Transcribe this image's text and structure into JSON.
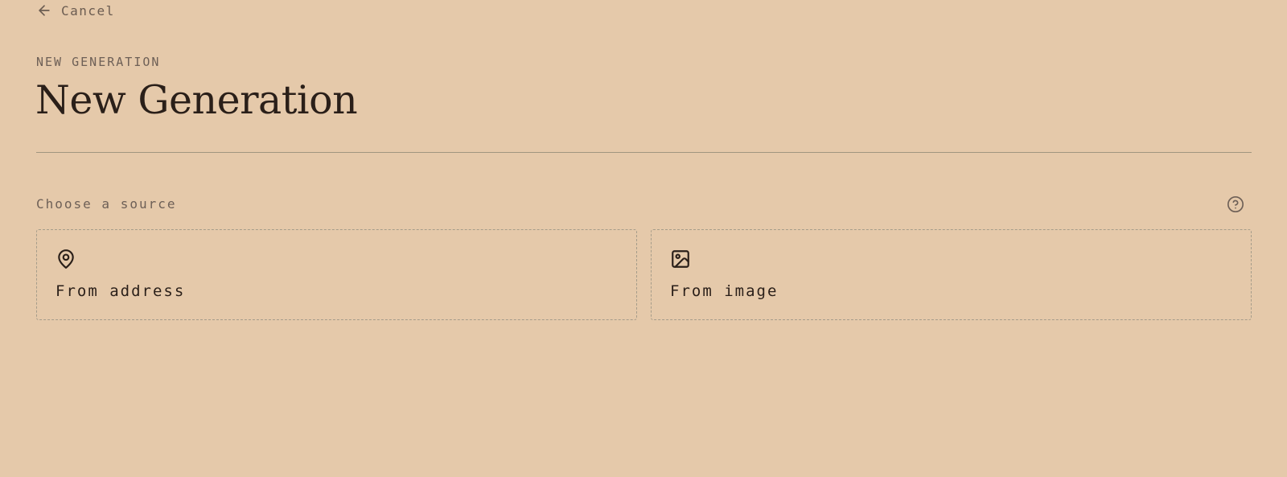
{
  "nav": {
    "cancel_label": "Cancel",
    "cancel_icon": "arrow-left-icon"
  },
  "header": {
    "eyebrow": "NEW GENERATION",
    "title": "New Generation"
  },
  "source_section": {
    "label": "Choose a source",
    "help_icon": "help-circle-icon",
    "options": [
      {
        "label": "From address",
        "icon": "map-pin-icon"
      },
      {
        "label": "From image",
        "icon": "image-icon"
      }
    ]
  },
  "colors": {
    "background": "#e5c9aa",
    "text_primary": "#2a1f19",
    "text_muted": "#6e6057",
    "divider": "#a0967f",
    "card_border": "#a59c8a"
  }
}
